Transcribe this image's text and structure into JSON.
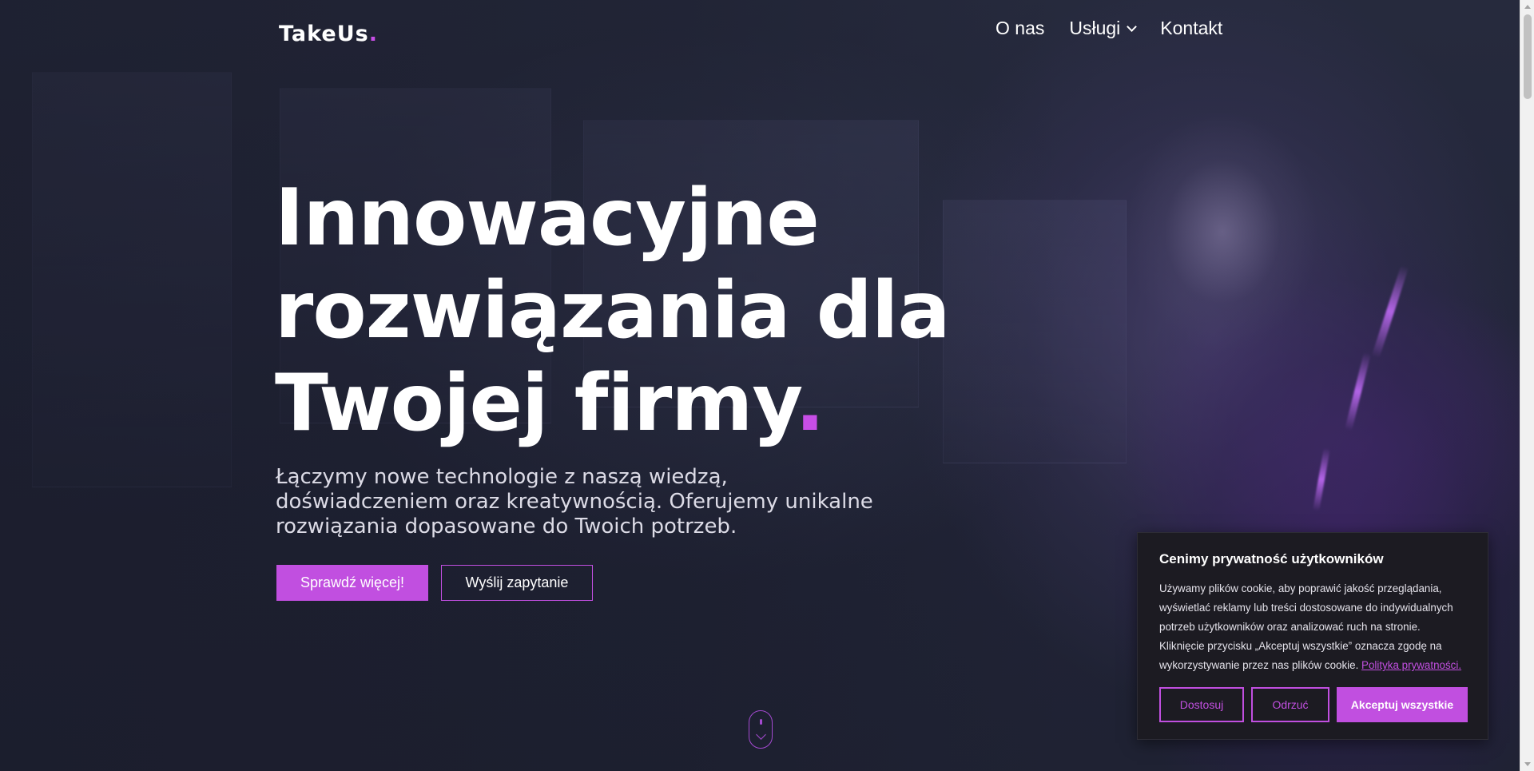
{
  "brand": {
    "logo_text": "TakeUs",
    "logo_dot": ".",
    "accent_color": "#c14fe0"
  },
  "nav": {
    "items": [
      {
        "label": "O nas"
      },
      {
        "label": "Usługi",
        "icon": "chevron-down-icon"
      },
      {
        "label": "Kontakt"
      }
    ]
  },
  "hero": {
    "title_line1": "Innowacyjne",
    "title_line2": "rozwiązania dla",
    "title_line3": "Twojej firmy",
    "title_dot": ".",
    "subtitle": "Łączymy nowe technologie z naszą wiedzą, doświadczeniem oraz kreatywnością. Oferujemy unikalne rozwiązania dopasowane do Twoich potrzeb.",
    "primary_button": "Sprawdź więcej!",
    "secondary_button": "Wyślij zapytanie",
    "scroll_icon": "mouse-scroll-icon"
  },
  "cookie_banner": {
    "title": "Cenimy prywatność użytkowników",
    "text": "Używamy plików cookie, aby poprawić jakość przeglądania, wyświetlać reklamy lub treści dostosowane do indywidualnych potrzeb użytkowników oraz analizować ruch na stronie. Kliknięcie przycisku „Akceptuj wszystkie” oznacza zgodę na wykorzystywanie przez nas plików cookie.",
    "link_text": "Polityka prywatności.",
    "buttons": {
      "customize": "Dostosuj",
      "reject": "Odrzuć",
      "accept_all": "Akceptuj wszystkie"
    }
  },
  "colors": {
    "background": "#1f2233",
    "accent": "#c14fe0",
    "cookie_bg": "#1c1b22"
  }
}
